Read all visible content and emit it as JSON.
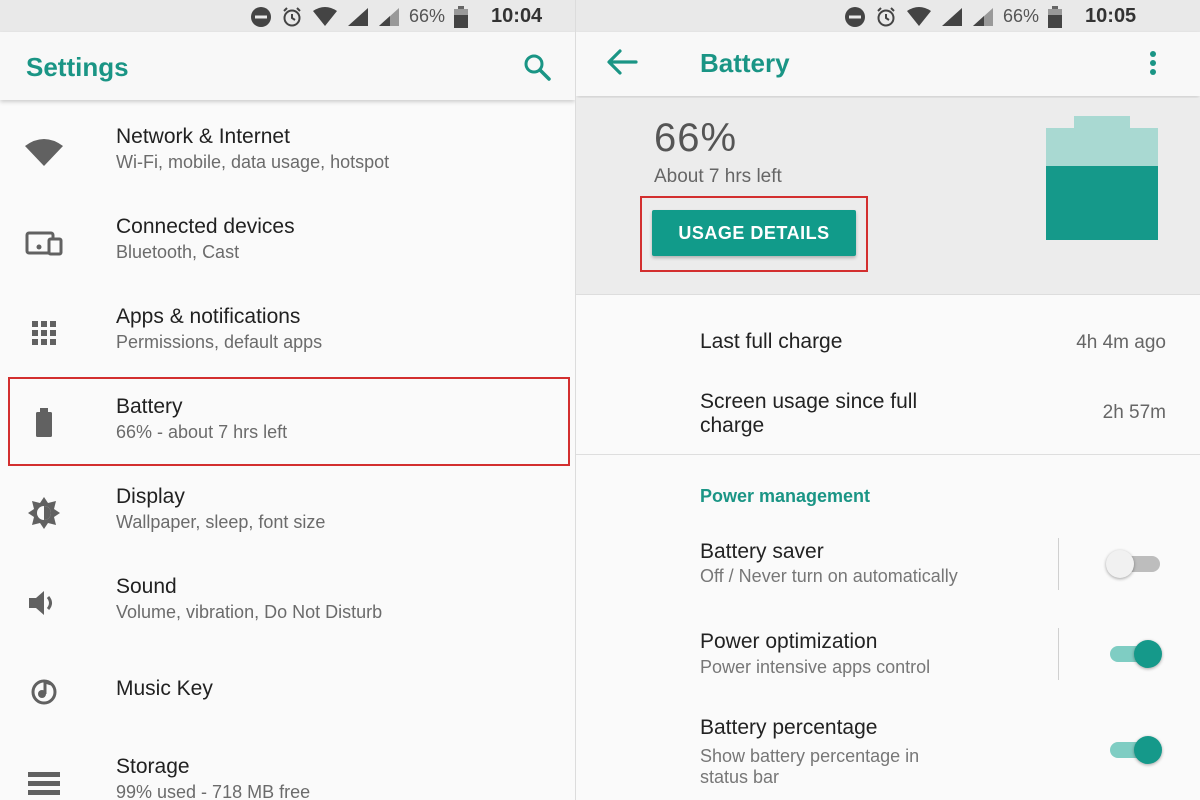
{
  "left": {
    "status_bar": {
      "battery_percent": "66%",
      "time": "10:04"
    },
    "app_bar": {
      "title": "Settings"
    },
    "items": [
      {
        "title": "Network & Internet",
        "subtitle": "Wi-Fi, mobile, data usage, hotspot",
        "icon": "wifi-icon"
      },
      {
        "title": "Connected devices",
        "subtitle": "Bluetooth, Cast",
        "icon": "devices-icon"
      },
      {
        "title": "Apps & notifications",
        "subtitle": "Permissions, default apps",
        "icon": "apps-grid-icon"
      },
      {
        "title": "Battery",
        "subtitle": "66% - about 7 hrs left",
        "icon": "battery-icon"
      },
      {
        "title": "Display",
        "subtitle": "Wallpaper, sleep, font size",
        "icon": "brightness-icon"
      },
      {
        "title": "Sound",
        "subtitle": "Volume, vibration, Do Not Disturb",
        "icon": "volume-icon"
      },
      {
        "title": "Music Key",
        "subtitle": "",
        "icon": "music-icon"
      },
      {
        "title": "Storage",
        "subtitle": "99% used - 718 MB free",
        "icon": "storage-icon"
      }
    ]
  },
  "right": {
    "status_bar": {
      "battery_percent": "66%",
      "time": "10:05"
    },
    "app_bar": {
      "title": "Battery"
    },
    "hero": {
      "percent": "66%",
      "time_left": "About 7 hrs left",
      "usage_button": "USAGE DETAILS",
      "charge_level": 0.66
    },
    "stats": [
      {
        "label": "Last full charge",
        "value": "4h 4m ago"
      },
      {
        "label_line1": "Screen usage since full",
        "label_line2": "charge",
        "value": "2h 57m"
      }
    ],
    "section_title": "Power management",
    "toggles": [
      {
        "title": "Battery saver",
        "subtitle": "Off / Never turn on automatically",
        "on": false
      },
      {
        "title": "Power optimization",
        "subtitle": "Power intensive apps control",
        "on": true
      },
      {
        "title": "Battery percentage",
        "subtitle_line1": "Show battery percentage in",
        "subtitle_line2": "status bar",
        "on": true
      }
    ]
  },
  "colors": {
    "accent": "#1a9585",
    "button": "#119b8a",
    "highlight": "#d32f2f",
    "toggle_on_thumb": "#15998a",
    "toggle_on_track": "#7fcdc3"
  }
}
